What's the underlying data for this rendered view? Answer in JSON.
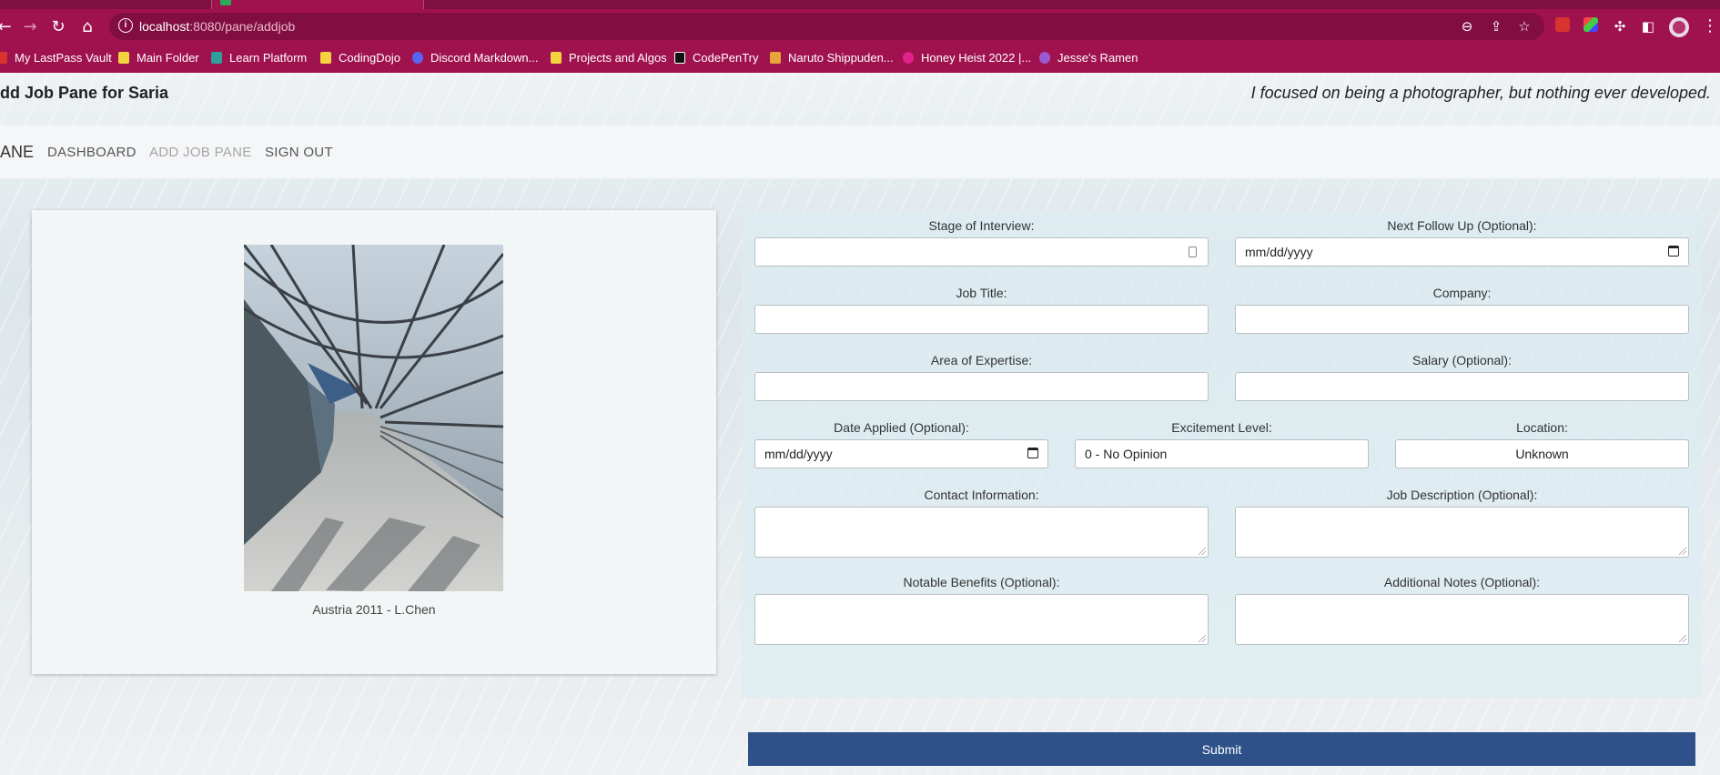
{
  "browser": {
    "url_host": "localhost",
    "url_path": ":8080/pane/addjob",
    "bookmarks": [
      {
        "label": "My LastPass Vault"
      },
      {
        "label": "Main Folder"
      },
      {
        "label": "Learn Platform"
      },
      {
        "label": "CodingDojo"
      },
      {
        "label": "Discord Markdown..."
      },
      {
        "label": "Projects and Algos"
      },
      {
        "label": "CodePenTry"
      },
      {
        "label": "Naruto Shippuden..."
      },
      {
        "label": "Honey Heist 2022 |..."
      },
      {
        "label": "Jesse's Ramen"
      }
    ]
  },
  "header": {
    "title": "dd Job Pane for Saria",
    "quote": "I focused on being a photographer, but nothing ever developed."
  },
  "nav": {
    "brand": "ANE",
    "links": [
      {
        "label": "DASHBOARD"
      },
      {
        "label": "ADD JOB PANE"
      },
      {
        "label": "SIGN OUT"
      }
    ]
  },
  "photo": {
    "caption": "Austria 2011 - L.Chen"
  },
  "form": {
    "stage_label": "Stage of Interview:",
    "stage_value": "",
    "follow_up_label": "Next Follow Up (Optional):",
    "follow_up_value": "mm/dd/yyyy",
    "job_title_label": "Job Title:",
    "company_label": "Company:",
    "expertise_label": "Area of Expertise:",
    "salary_label": "Salary (Optional):",
    "date_applied_label": "Date Applied (Optional):",
    "date_applied_value": "mm/dd/yyyy",
    "excitement_label": "Excitement Level:",
    "excitement_value": "0 - No Opinion",
    "location_label": "Location:",
    "location_value": "Unknown",
    "contact_label": "Contact Information:",
    "description_label": "Job Description (Optional):",
    "benefits_label": "Notable Benefits (Optional):",
    "notes_label": "Additional Notes (Optional):",
    "submit_label": "Submit"
  },
  "colors": {
    "browser_chrome": "#a0124e",
    "submit_button": "#2e5189"
  }
}
